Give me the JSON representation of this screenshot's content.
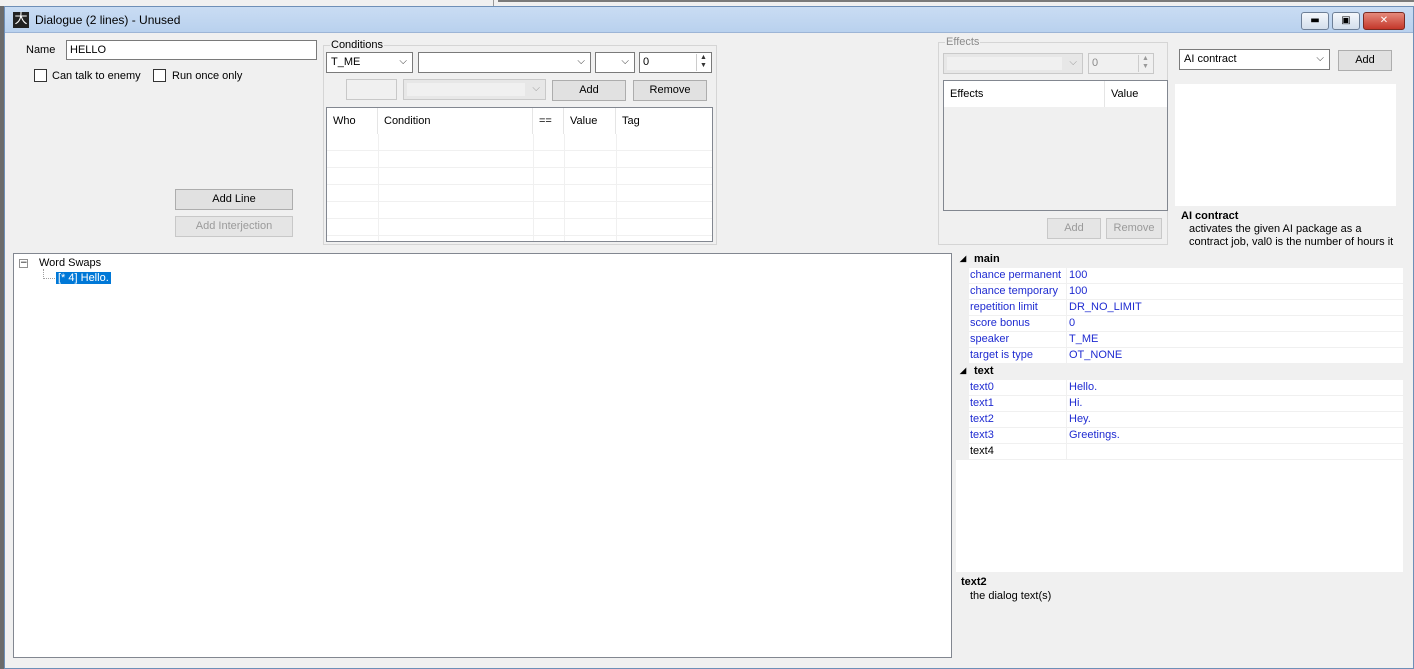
{
  "window": {
    "title": "Dialogue (2 lines) - Unused",
    "minimize": "▬",
    "restore": "▣",
    "close": "✕"
  },
  "name_field": {
    "label": "Name",
    "value": "HELLO"
  },
  "options": {
    "can_talk_to_enemy": {
      "label": "Can talk to enemy",
      "checked": false
    },
    "run_once_only": {
      "label": "Run once only",
      "checked": false
    }
  },
  "buttons": {
    "add_line": "Add Line",
    "add_interjection": "Add Interjection"
  },
  "conditions": {
    "group_title": "Conditions",
    "who_combo": "T_ME",
    "condition_combo": "",
    "comparison_combo": "",
    "value_spinner": "0",
    "tag_combo": "",
    "add": "Add",
    "remove": "Remove",
    "columns": [
      "Who",
      "Condition",
      "==",
      "Value",
      "Tag"
    ]
  },
  "effects": {
    "group_title": "Effects",
    "effect_combo": "",
    "value_spinner": "0",
    "columns": [
      "Effects",
      "Value"
    ],
    "add": "Add",
    "remove": "Remove"
  },
  "package": {
    "combo": "AI contract",
    "add": "Add",
    "desc_title": "AI contract",
    "desc_text_line1": "activates the given AI package as a",
    "desc_text_line2": "contract job, val0 is the number of hours it"
  },
  "tree": {
    "root": "Word Swaps",
    "child": "[* 4] Hello."
  },
  "property_grid": {
    "categories": [
      {
        "name": "main",
        "rows": [
          {
            "name": "chance permanent",
            "value": "100"
          },
          {
            "name": "chance temporary",
            "value": "100"
          },
          {
            "name": "repetition limit",
            "value": "DR_NO_LIMIT"
          },
          {
            "name": "score bonus",
            "value": "0"
          },
          {
            "name": "speaker",
            "value": "T_ME"
          },
          {
            "name": "target is type",
            "value": "OT_NONE"
          }
        ]
      },
      {
        "name": "text",
        "rows": [
          {
            "name": "text0",
            "value": "Hello."
          },
          {
            "name": "text1",
            "value": "Hi."
          },
          {
            "name": "text2",
            "value": "Hey."
          },
          {
            "name": "text3",
            "value": "Greetings."
          },
          {
            "name": "text4",
            "value": ""
          }
        ]
      }
    ],
    "desc_title": "text2",
    "desc_text": "the dialog text(s)"
  },
  "colors": {
    "selection": "#0078d7",
    "property_text": "#1f2bd1"
  },
  "icons": {
    "app": "dancer-icon",
    "collapse": "tree-collapse-icon"
  }
}
